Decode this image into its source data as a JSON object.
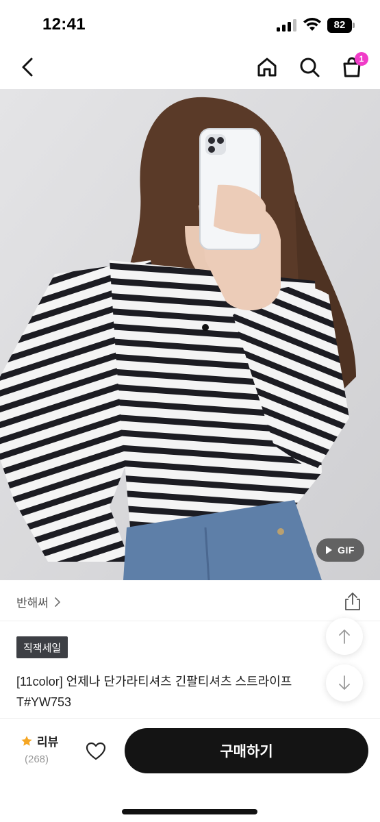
{
  "status": {
    "time": "12:41",
    "battery": "82"
  },
  "nav": {
    "cart_count": "1"
  },
  "media": {
    "gif_label": "GIF"
  },
  "brand": {
    "name": "반해써"
  },
  "product": {
    "tag": "직잭세일",
    "title": "[11color] 언제나 단가라티셔츠 긴팔티셔츠 스트라이프 T#YW753"
  },
  "bottom": {
    "review_label": "리뷰",
    "review_count": "(268)",
    "buy_label": "구매하기"
  },
  "colors": {
    "accent_badge": "#f03cc8",
    "star": "#f5a623",
    "buy_button": "#141414"
  }
}
